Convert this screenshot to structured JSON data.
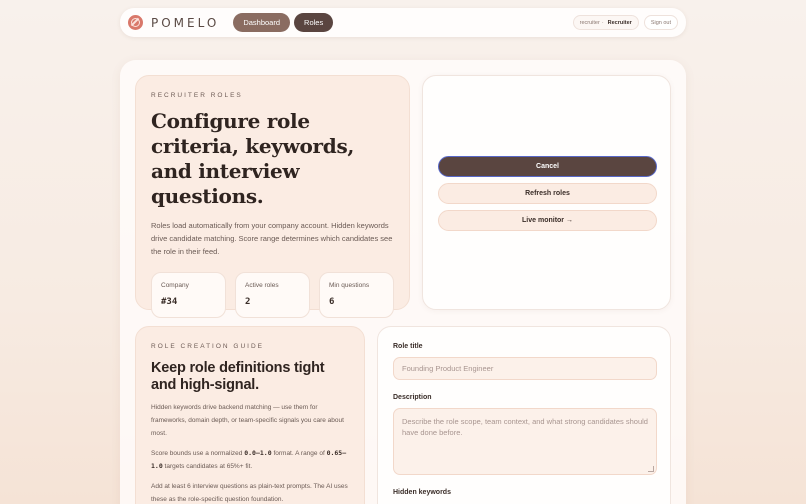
{
  "nav": {
    "brand": "POMELO",
    "dashboard": "Dashboard",
    "roles": "Roles",
    "user_prefix": "recruiter",
    "user_sep": "·",
    "user_role": "Recruiter",
    "signout": "Sign out"
  },
  "hero": {
    "eyebrow": "RECRUITER ROLES",
    "title": "Configure role criteria, keywords, and interview questions.",
    "description": "Roles load automatically from your company account. Hidden keywords drive candidate matching. Score range determines which candidates see the role in their feed.",
    "stats": [
      {
        "label": "Company",
        "value": "#34"
      },
      {
        "label": "Active roles",
        "value": "2"
      },
      {
        "label": "Min questions",
        "value": "6"
      }
    ]
  },
  "actions": {
    "cancel": "Cancel",
    "refresh": "Refresh roles",
    "monitor": "Live monitor →"
  },
  "guide": {
    "eyebrow": "ROLE CREATION GUIDE",
    "title": "Keep role definitions tight and high-signal.",
    "p1": "Hidden keywords drive backend matching — use them for frameworks, domain depth, or team-specific signals you care about most.",
    "p2_a": "Score bounds use a normalized ",
    "p2_code": "0.0–1.0",
    "p2_b": " format. A range of ",
    "p2_code2": "0.65–1.0",
    "p2_c": " targets candidates at 65%+ fit.",
    "p3": "Add at least 6 interview questions as plain-text prompts. The AI uses these as the role-specific question foundation."
  },
  "form": {
    "title_label": "Role title",
    "title_placeholder": "Founding Product Engineer",
    "desc_label": "Description",
    "desc_placeholder": "Describe the role scope, team context, and what strong candidates should have done before.",
    "keywords_label": "Hidden keywords"
  }
}
